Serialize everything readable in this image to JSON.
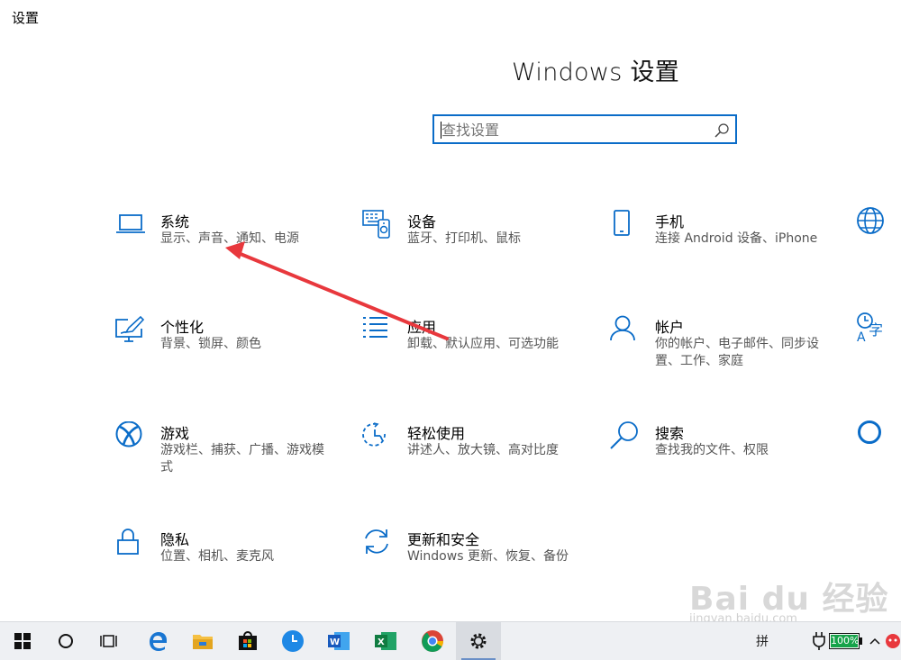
{
  "app": {
    "title": "设置",
    "heading": "Windows 设置"
  },
  "search": {
    "placeholder": "查找设置"
  },
  "tiles": [
    {
      "name": "系统",
      "desc": "显示、声音、通知、电源",
      "icon": "laptop-icon"
    },
    {
      "name": "设备",
      "desc": "蓝牙、打印机、鼠标",
      "icon": "devices-icon"
    },
    {
      "name": "手机",
      "desc": "连接 Android 设备、iPhone",
      "icon": "phone-icon"
    },
    {
      "name": "个性化",
      "desc": "背景、锁屏、颜色",
      "icon": "personalization-icon"
    },
    {
      "name": "应用",
      "desc": "卸载、默认应用、可选功能",
      "icon": "apps-icon"
    },
    {
      "name": "帐户",
      "desc": "你的帐户、电子邮件、同步设置、工作、家庭",
      "icon": "account-icon"
    },
    {
      "name": "游戏",
      "desc": "游戏栏、捕获、广播、游戏模式",
      "icon": "xbox-icon"
    },
    {
      "name": "轻松使用",
      "desc": "讲述人、放大镜、高对比度",
      "icon": "ease-of-access-icon"
    },
    {
      "name": "搜索",
      "desc": "查找我的文件、权限",
      "icon": "search-icon"
    },
    {
      "name": "隐私",
      "desc": "位置、相机、麦克风",
      "icon": "lock-icon"
    },
    {
      "name": "更新和安全",
      "desc": "Windows 更新、恢复、备份",
      "icon": "update-icon"
    }
  ],
  "taskbar": {
    "battery": "100%",
    "ime": "拼",
    "icons": [
      "windows-start-icon",
      "cortana-icon",
      "task-view-icon",
      "edge-icon",
      "file-explorer-icon",
      "store-icon",
      "clock-app-icon",
      "word-icon",
      "excel-icon",
      "chrome-icon",
      "settings-icon"
    ]
  },
  "watermark": {
    "brand": "Bai du 经验",
    "url": "jingyan.baidu.com"
  },
  "colors": {
    "accent": "#0a6cc8",
    "arrow": "#e8383d"
  }
}
